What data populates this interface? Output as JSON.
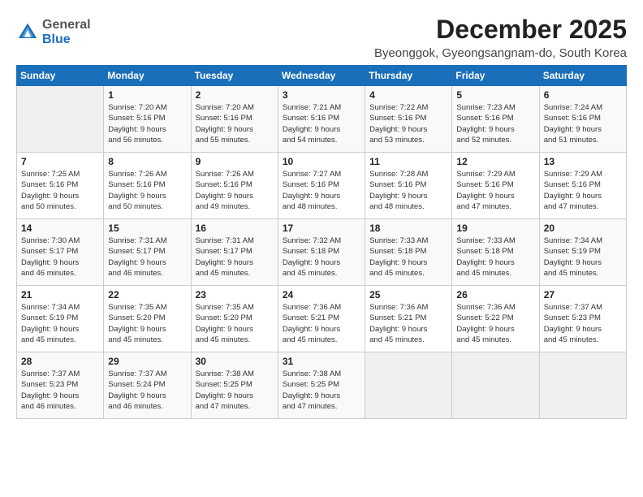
{
  "logo": {
    "general": "General",
    "blue": "Blue"
  },
  "header": {
    "title": "December 2025",
    "subtitle": "Byeonggok, Gyeongsangnam-do, South Korea"
  },
  "columns": [
    "Sunday",
    "Monday",
    "Tuesday",
    "Wednesday",
    "Thursday",
    "Friday",
    "Saturday"
  ],
  "weeks": [
    [
      {
        "day": "",
        "info": ""
      },
      {
        "day": "1",
        "info": "Sunrise: 7:20 AM\nSunset: 5:16 PM\nDaylight: 9 hours\nand 56 minutes."
      },
      {
        "day": "2",
        "info": "Sunrise: 7:20 AM\nSunset: 5:16 PM\nDaylight: 9 hours\nand 55 minutes."
      },
      {
        "day": "3",
        "info": "Sunrise: 7:21 AM\nSunset: 5:16 PM\nDaylight: 9 hours\nand 54 minutes."
      },
      {
        "day": "4",
        "info": "Sunrise: 7:22 AM\nSunset: 5:16 PM\nDaylight: 9 hours\nand 53 minutes."
      },
      {
        "day": "5",
        "info": "Sunrise: 7:23 AM\nSunset: 5:16 PM\nDaylight: 9 hours\nand 52 minutes."
      },
      {
        "day": "6",
        "info": "Sunrise: 7:24 AM\nSunset: 5:16 PM\nDaylight: 9 hours\nand 51 minutes."
      }
    ],
    [
      {
        "day": "7",
        "info": "Sunrise: 7:25 AM\nSunset: 5:16 PM\nDaylight: 9 hours\nand 50 minutes."
      },
      {
        "day": "8",
        "info": "Sunrise: 7:26 AM\nSunset: 5:16 PM\nDaylight: 9 hours\nand 50 minutes."
      },
      {
        "day": "9",
        "info": "Sunrise: 7:26 AM\nSunset: 5:16 PM\nDaylight: 9 hours\nand 49 minutes."
      },
      {
        "day": "10",
        "info": "Sunrise: 7:27 AM\nSunset: 5:16 PM\nDaylight: 9 hours\nand 48 minutes."
      },
      {
        "day": "11",
        "info": "Sunrise: 7:28 AM\nSunset: 5:16 PM\nDaylight: 9 hours\nand 48 minutes."
      },
      {
        "day": "12",
        "info": "Sunrise: 7:29 AM\nSunset: 5:16 PM\nDaylight: 9 hours\nand 47 minutes."
      },
      {
        "day": "13",
        "info": "Sunrise: 7:29 AM\nSunset: 5:16 PM\nDaylight: 9 hours\nand 47 minutes."
      }
    ],
    [
      {
        "day": "14",
        "info": "Sunrise: 7:30 AM\nSunset: 5:17 PM\nDaylight: 9 hours\nand 46 minutes."
      },
      {
        "day": "15",
        "info": "Sunrise: 7:31 AM\nSunset: 5:17 PM\nDaylight: 9 hours\nand 46 minutes."
      },
      {
        "day": "16",
        "info": "Sunrise: 7:31 AM\nSunset: 5:17 PM\nDaylight: 9 hours\nand 45 minutes."
      },
      {
        "day": "17",
        "info": "Sunrise: 7:32 AM\nSunset: 5:18 PM\nDaylight: 9 hours\nand 45 minutes."
      },
      {
        "day": "18",
        "info": "Sunrise: 7:33 AM\nSunset: 5:18 PM\nDaylight: 9 hours\nand 45 minutes."
      },
      {
        "day": "19",
        "info": "Sunrise: 7:33 AM\nSunset: 5:18 PM\nDaylight: 9 hours\nand 45 minutes."
      },
      {
        "day": "20",
        "info": "Sunrise: 7:34 AM\nSunset: 5:19 PM\nDaylight: 9 hours\nand 45 minutes."
      }
    ],
    [
      {
        "day": "21",
        "info": "Sunrise: 7:34 AM\nSunset: 5:19 PM\nDaylight: 9 hours\nand 45 minutes."
      },
      {
        "day": "22",
        "info": "Sunrise: 7:35 AM\nSunset: 5:20 PM\nDaylight: 9 hours\nand 45 minutes."
      },
      {
        "day": "23",
        "info": "Sunrise: 7:35 AM\nSunset: 5:20 PM\nDaylight: 9 hours\nand 45 minutes."
      },
      {
        "day": "24",
        "info": "Sunrise: 7:36 AM\nSunset: 5:21 PM\nDaylight: 9 hours\nand 45 minutes."
      },
      {
        "day": "25",
        "info": "Sunrise: 7:36 AM\nSunset: 5:21 PM\nDaylight: 9 hours\nand 45 minutes."
      },
      {
        "day": "26",
        "info": "Sunrise: 7:36 AM\nSunset: 5:22 PM\nDaylight: 9 hours\nand 45 minutes."
      },
      {
        "day": "27",
        "info": "Sunrise: 7:37 AM\nSunset: 5:23 PM\nDaylight: 9 hours\nand 45 minutes."
      }
    ],
    [
      {
        "day": "28",
        "info": "Sunrise: 7:37 AM\nSunset: 5:23 PM\nDaylight: 9 hours\nand 46 minutes."
      },
      {
        "day": "29",
        "info": "Sunrise: 7:37 AM\nSunset: 5:24 PM\nDaylight: 9 hours\nand 46 minutes."
      },
      {
        "day": "30",
        "info": "Sunrise: 7:38 AM\nSunset: 5:25 PM\nDaylight: 9 hours\nand 47 minutes."
      },
      {
        "day": "31",
        "info": "Sunrise: 7:38 AM\nSunset: 5:25 PM\nDaylight: 9 hours\nand 47 minutes."
      },
      {
        "day": "",
        "info": ""
      },
      {
        "day": "",
        "info": ""
      },
      {
        "day": "",
        "info": ""
      }
    ]
  ]
}
